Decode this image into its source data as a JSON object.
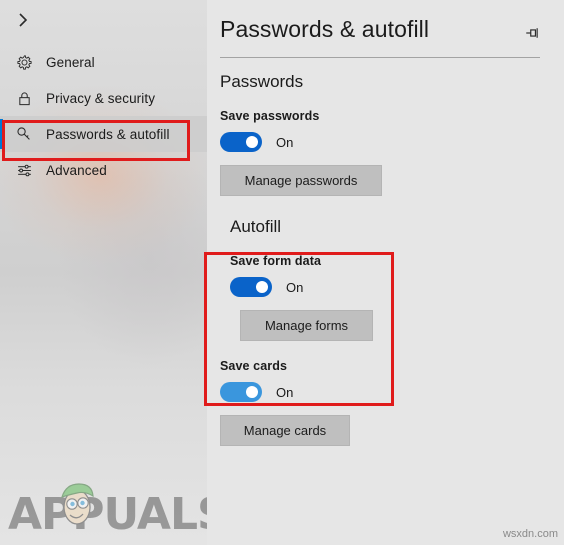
{
  "window": {
    "background_color": "#e6e6e6"
  },
  "sidebar": {
    "expand_icon": "chevron-right-icon",
    "accent_color": "#0078d4",
    "items": [
      {
        "label": "General",
        "icon": "gear-icon",
        "selected": false
      },
      {
        "label": "Privacy & security",
        "icon": "lock-icon",
        "selected": false
      },
      {
        "label": "Passwords & autofill",
        "icon": "key-icon",
        "selected": true
      },
      {
        "label": "Advanced",
        "icon": "sliders-icon",
        "selected": false
      }
    ]
  },
  "header": {
    "title": "Passwords & autofill",
    "pin_icon": "pin-icon"
  },
  "passwords_section": {
    "title": "Passwords",
    "save_passwords": {
      "label": "Save passwords",
      "state": "On",
      "toggle_color": "#0a63c9"
    },
    "manage_button": "Manage passwords"
  },
  "autofill_section": {
    "title": "Autofill",
    "save_form_data": {
      "label": "Save form data",
      "state": "On",
      "toggle_color": "#0a63c9"
    },
    "manage_button": "Manage forms",
    "highlight_color": "#e01b1b"
  },
  "cards_section": {
    "save_cards": {
      "label": "Save cards",
      "state": "On",
      "toggle_color": "#3a96dd"
    },
    "manage_button": "Manage cards"
  },
  "watermarks": {
    "logo_text": "APPUALS",
    "site": "wsxdn.com"
  }
}
